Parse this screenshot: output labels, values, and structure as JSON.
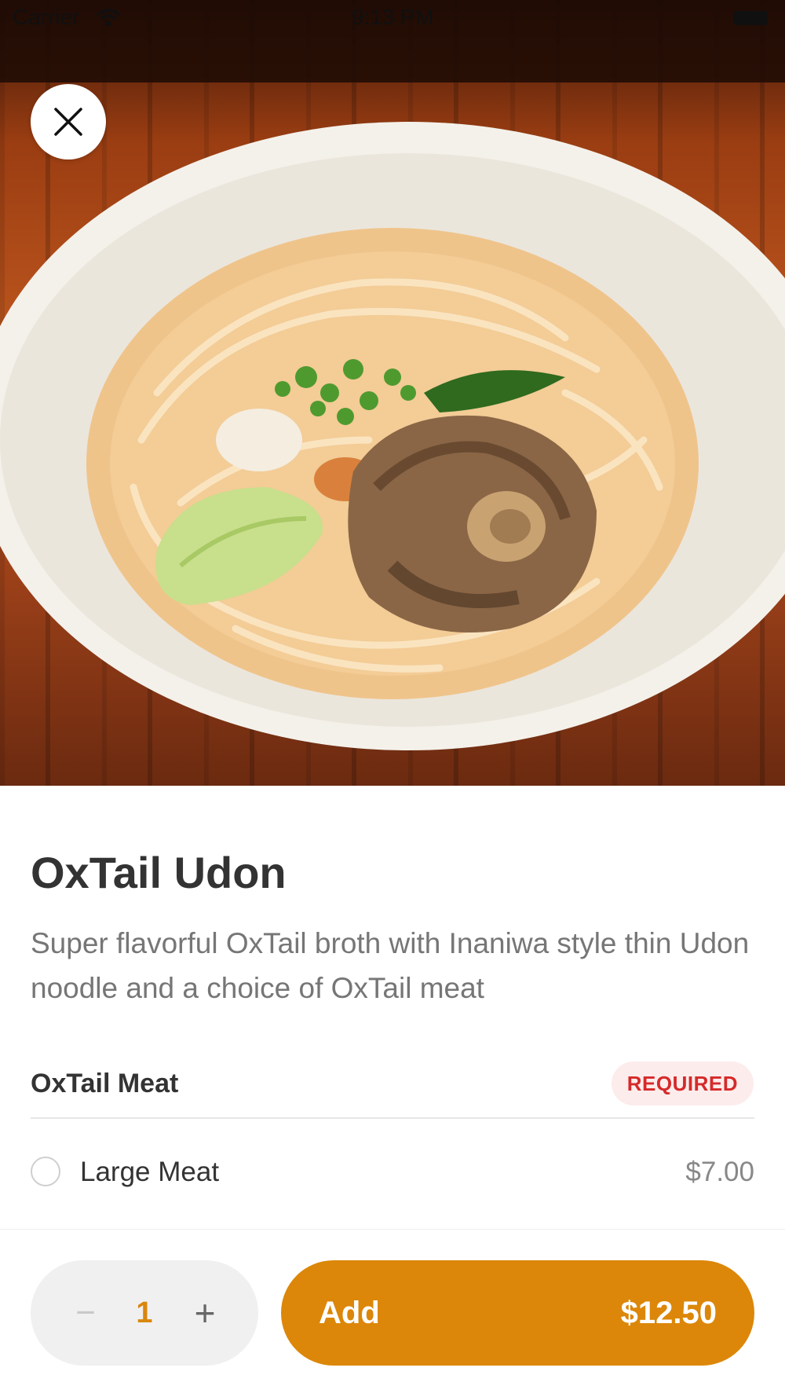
{
  "status_bar": {
    "carrier": "Carrier",
    "time": "9:13 PM"
  },
  "item": {
    "title": "OxTail Udon",
    "description": "Super flavorful OxTail broth with Inaniwa style thin Udon noodle and a choice of OxTail meat"
  },
  "option_group": {
    "name": "OxTail Meat",
    "badge": "REQUIRED",
    "options": [
      {
        "label": "Large Meat",
        "price": "$7.00",
        "selected": false
      }
    ]
  },
  "footer": {
    "minus_symbol": "−",
    "quantity": "1",
    "plus_symbol": "+",
    "add_label": "Add",
    "total": "$12.50"
  },
  "icons": {
    "close": "close-icon",
    "wifi": "wifi-icon",
    "battery": "battery-icon"
  },
  "colors": {
    "accent": "#dc8709",
    "required_text": "#d52a2a",
    "required_bg": "#fdecec"
  }
}
